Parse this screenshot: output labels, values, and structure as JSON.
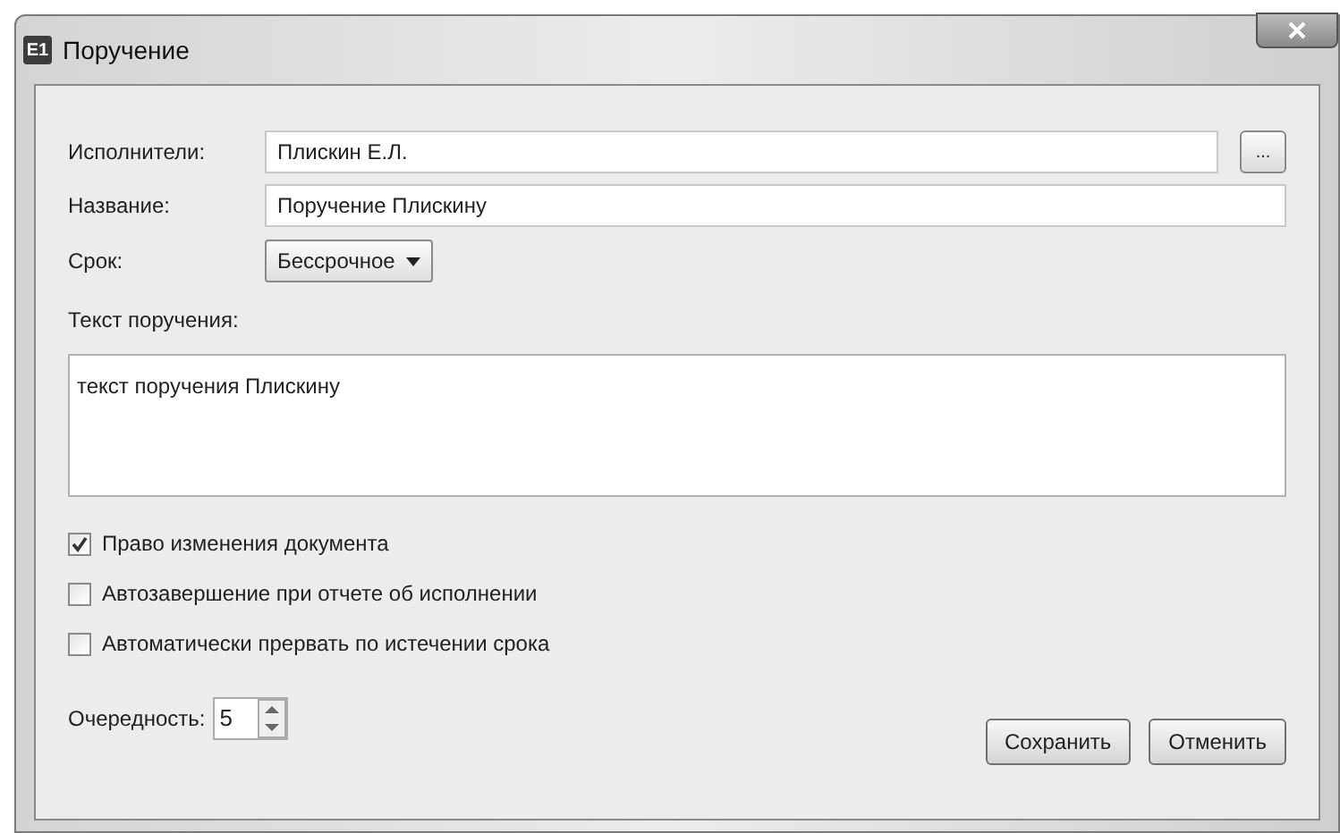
{
  "window": {
    "icon_text": "E1",
    "title": "Поручение"
  },
  "fields": [
    {
      "label": "Исполнители:",
      "value": "Плискин Е.Л.",
      "browse": "..."
    },
    {
      "label": "Название:",
      "value": "Поручение Плискину"
    }
  ],
  "term": {
    "label": "Срок:",
    "value": "Бессрочное"
  },
  "text": {
    "label": "Текст поручения:",
    "value": "текст поручения Плискину"
  },
  "options": [
    {
      "label": "Право изменения документа",
      "checked": true
    },
    {
      "label": "Автозавершение при отчете об исполнении",
      "checked": false
    },
    {
      "label": "Автоматически прервать по истечении срока",
      "checked": false
    }
  ],
  "priority": {
    "label": "Очередность:",
    "value": "5"
  },
  "buttons": [
    "Сохранить",
    "Отменить"
  ]
}
